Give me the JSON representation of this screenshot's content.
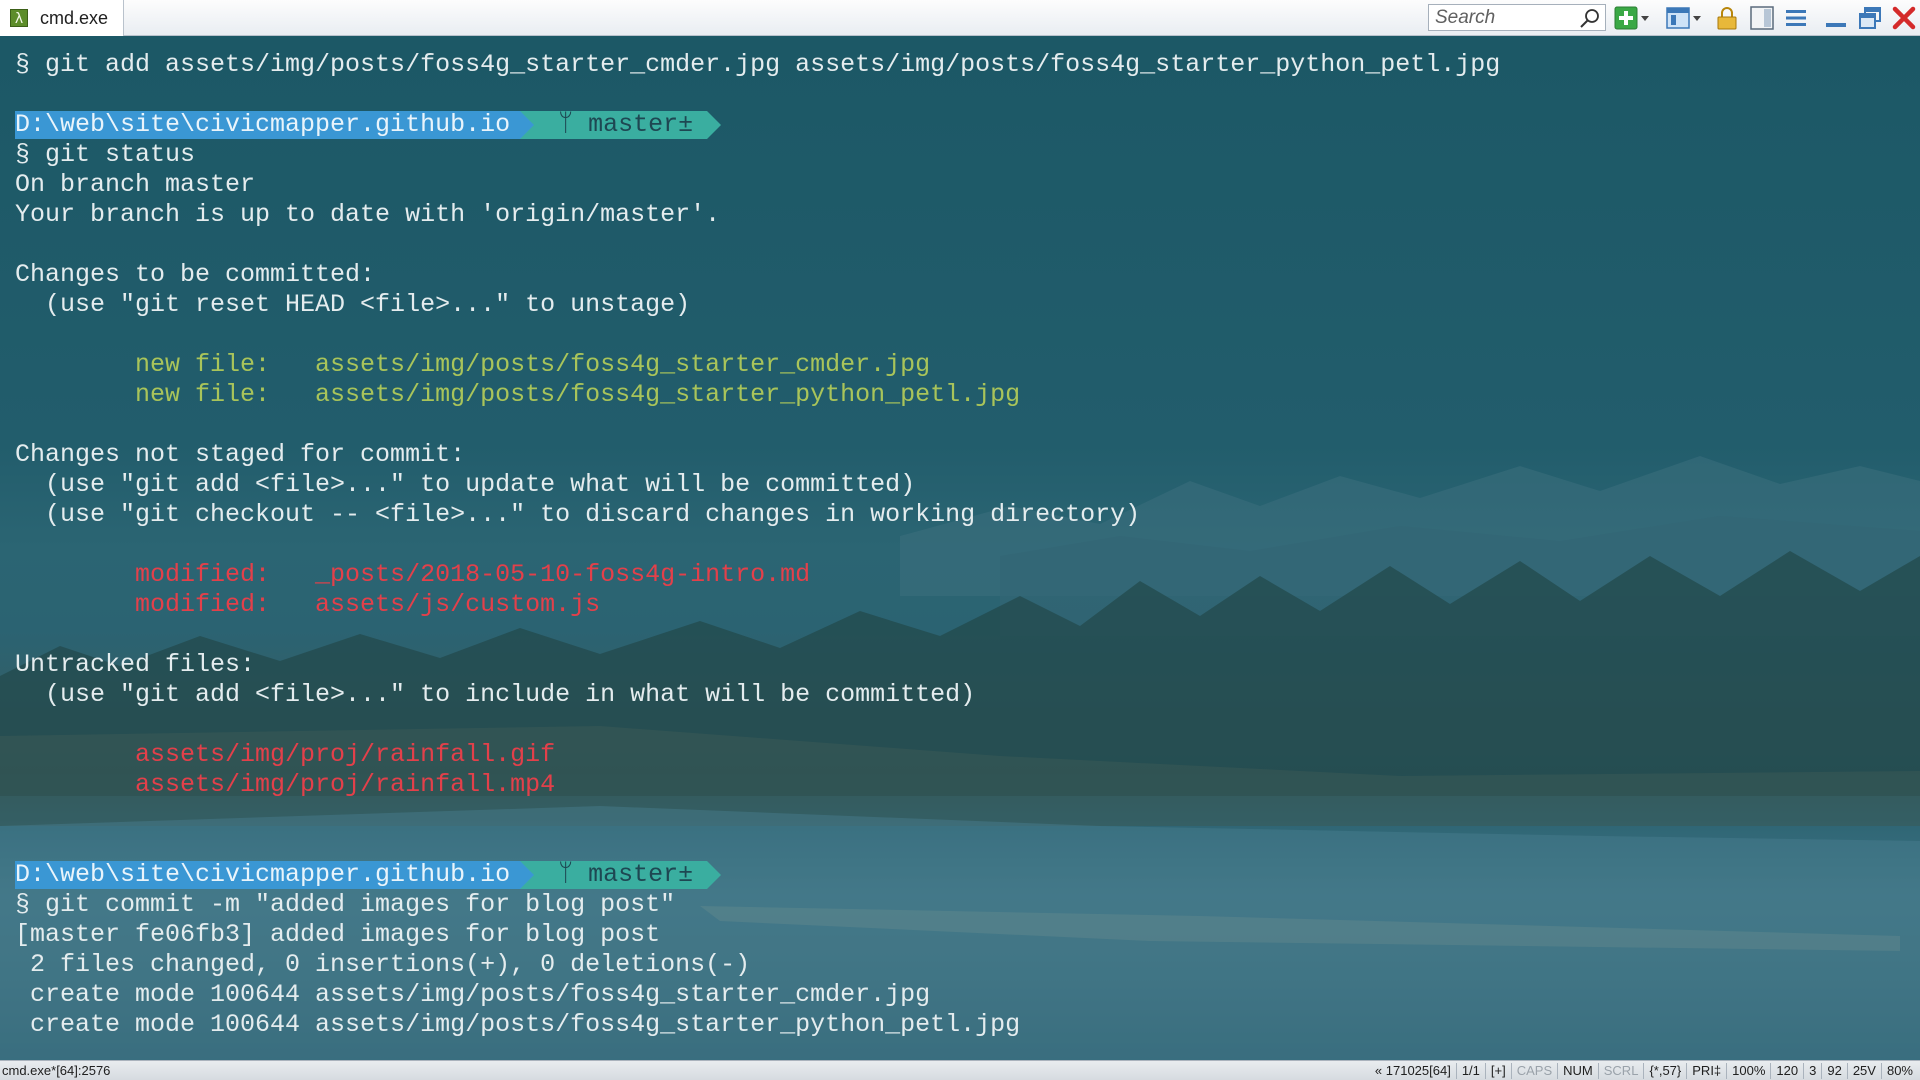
{
  "window": {
    "tab_label": "cmd.exe",
    "tab_icon": "lambda-icon",
    "search_placeholder": "Search"
  },
  "toolbar": {
    "icons": [
      "search-icon",
      "new-console-icon",
      "dropdown-icon",
      "split-view-icon",
      "dropdown-icon",
      "lock-icon",
      "layout-icon",
      "menu-icon",
      "minimize-icon",
      "restore-icon",
      "close-icon"
    ]
  },
  "prompt": {
    "path": "D:\\web\\site\\civicmapper.github.io",
    "branch_symbol": "ᛘ",
    "branch": "master±"
  },
  "console": {
    "lines": [
      {
        "type": "text",
        "text": "§ git add assets/img/posts/foss4g_starter_cmder.jpg assets/img/posts/foss4g_starter_python_petl.jpg"
      },
      {
        "type": "blank",
        "text": ""
      },
      {
        "type": "prompt",
        "text": ""
      },
      {
        "type": "text",
        "text": "§ git status"
      },
      {
        "type": "text",
        "text": "On branch master"
      },
      {
        "type": "text",
        "text": "Your branch is up to date with 'origin/master'."
      },
      {
        "type": "blank",
        "text": ""
      },
      {
        "type": "text",
        "text": "Changes to be committed:"
      },
      {
        "type": "text",
        "text": "  (use \"git reset HEAD <file>...\" to unstage)"
      },
      {
        "type": "blank",
        "text": ""
      },
      {
        "type": "green",
        "text": "        new file:   assets/img/posts/foss4g_starter_cmder.jpg"
      },
      {
        "type": "green",
        "text": "        new file:   assets/img/posts/foss4g_starter_python_petl.jpg"
      },
      {
        "type": "blank",
        "text": ""
      },
      {
        "type": "text",
        "text": "Changes not staged for commit:"
      },
      {
        "type": "text",
        "text": "  (use \"git add <file>...\" to update what will be committed)"
      },
      {
        "type": "text",
        "text": "  (use \"git checkout -- <file>...\" to discard changes in working directory)"
      },
      {
        "type": "blank",
        "text": ""
      },
      {
        "type": "red",
        "text": "        modified:   _posts/2018-05-10-foss4g-intro.md"
      },
      {
        "type": "red",
        "text": "        modified:   assets/js/custom.js"
      },
      {
        "type": "blank",
        "text": ""
      },
      {
        "type": "text",
        "text": "Untracked files:"
      },
      {
        "type": "text",
        "text": "  (use \"git add <file>...\" to include in what will be committed)"
      },
      {
        "type": "blank",
        "text": ""
      },
      {
        "type": "red",
        "text": "        assets/img/proj/rainfall.gif"
      },
      {
        "type": "red",
        "text": "        assets/img/proj/rainfall.mp4"
      },
      {
        "type": "blank",
        "text": ""
      },
      {
        "type": "blank",
        "text": ""
      },
      {
        "type": "prompt",
        "text": ""
      },
      {
        "type": "text",
        "text": "§ git commit -m \"added images for blog post\""
      },
      {
        "type": "text",
        "text": "[master fe06fb3] added images for blog post"
      },
      {
        "type": "text",
        "text": " 2 files changed, 0 insertions(+), 0 deletions(-)"
      },
      {
        "type": "text",
        "text": " create mode 100644 assets/img/posts/foss4g_starter_cmder.jpg"
      },
      {
        "type": "text",
        "text": " create mode 100644 assets/img/posts/foss4g_starter_python_petl.jpg"
      }
    ]
  },
  "statusbar": {
    "left": "cmd.exe*[64]:2576",
    "right": [
      {
        "text": "« 171025[64]",
        "dim": false
      },
      {
        "text": "1/1",
        "dim": false
      },
      {
        "text": "[+]",
        "dim": false
      },
      {
        "text": "CAPS",
        "dim": true
      },
      {
        "text": "NUM",
        "dim": false
      },
      {
        "text": "SCRL",
        "dim": true
      },
      {
        "text": "{*,57}",
        "dim": false
      },
      {
        "text": "PRI‡",
        "dim": false
      },
      {
        "text": "100%",
        "dim": false
      },
      {
        "text": "120",
        "dim": false
      },
      {
        "text": "3",
        "dim": false
      },
      {
        "text": "92",
        "dim": false
      },
      {
        "text": "25V",
        "dim": false
      },
      {
        "text": "80%",
        "dim": false
      }
    ]
  },
  "colors": {
    "text": "#e4ecee",
    "green": "#a9c45a",
    "red": "#e3404a",
    "prompt_path_bg": "#3a97d4",
    "prompt_branch_bg": "#3aaea0"
  }
}
